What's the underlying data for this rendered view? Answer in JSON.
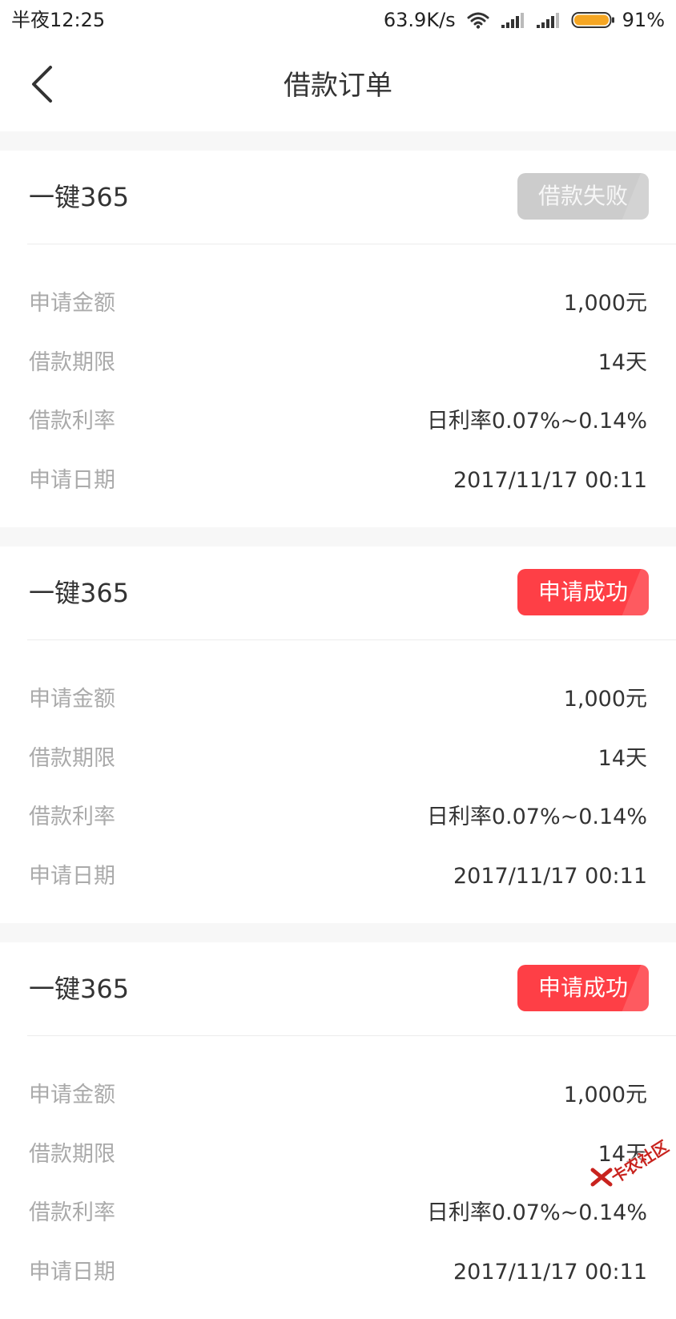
{
  "status_bar": {
    "time": "半夜12:25",
    "net_speed": "63.9K/s",
    "battery_pct": "91%"
  },
  "header": {
    "title": "借款订单"
  },
  "orders": [
    {
      "name": "一键365",
      "status": "借款失败",
      "status_type": "fail",
      "rows": [
        {
          "label": "申请金额",
          "value": "1,000元"
        },
        {
          "label": "借款期限",
          "value": "14天"
        },
        {
          "label": "借款利率",
          "value": "日利率0.07%~0.14%"
        },
        {
          "label": "申请日期",
          "value": "2017/11/17 00:11"
        }
      ]
    },
    {
      "name": "一键365",
      "status": "申请成功",
      "status_type": "success",
      "rows": [
        {
          "label": "申请金额",
          "value": "1,000元"
        },
        {
          "label": "借款期限",
          "value": "14天"
        },
        {
          "label": "借款利率",
          "value": "日利率0.07%~0.14%"
        },
        {
          "label": "申请日期",
          "value": "2017/11/17 00:11"
        }
      ]
    },
    {
      "name": "一键365",
      "status": "申请成功",
      "status_type": "success",
      "rows": [
        {
          "label": "申请金额",
          "value": "1,000元"
        },
        {
          "label": "借款期限",
          "value": "14天"
        },
        {
          "label": "借款利率",
          "value": "日利率0.07%~0.14%"
        },
        {
          "label": "申请日期",
          "value": "2017/11/17 00:11"
        }
      ]
    }
  ],
  "watermark": {
    "text": "卡农社区"
  },
  "colors": {
    "accent": "#fe3f46",
    "fail_badge": "#cccccc",
    "battery": "#f5a623"
  }
}
